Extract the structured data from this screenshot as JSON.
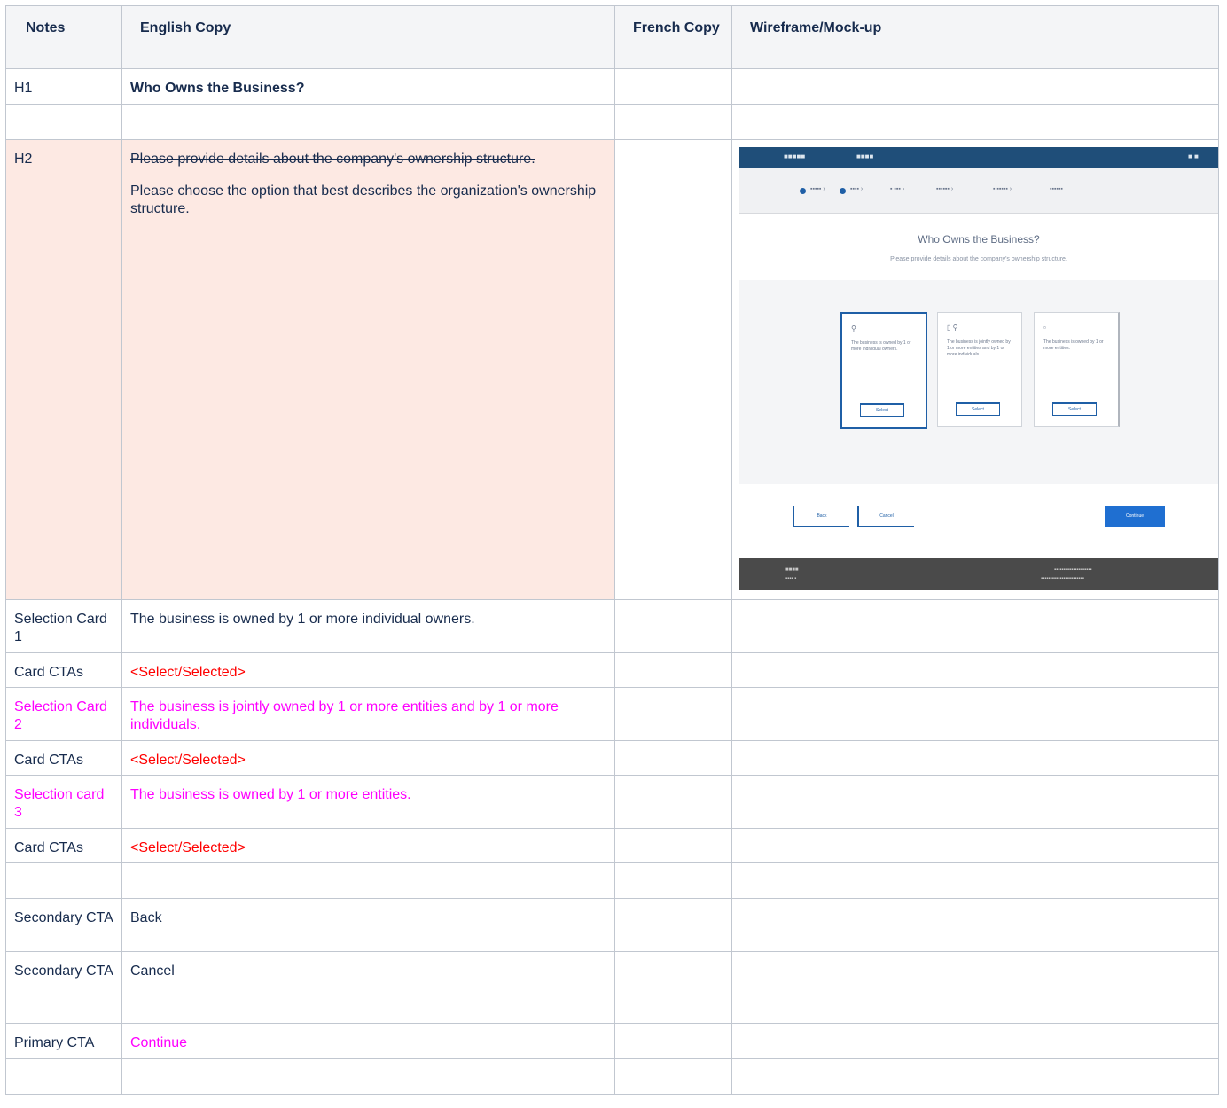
{
  "headers": {
    "notes": "Notes",
    "english": "English Copy",
    "french": "French Copy",
    "wireframe": "Wireframe/Mock-up"
  },
  "rows": [
    {
      "note": "H1",
      "copy": "Who Owns the Business?"
    },
    {
      "note": "",
      "copy": ""
    },
    {
      "note": "H2",
      "copy_struck": "Please provide details about the company's ownership structure.",
      "copy": "Please choose the option that best describes the organization's ownership structure."
    },
    {
      "note": "Selection Card 1",
      "copy": "The business is owned by 1 or more individual owners."
    },
    {
      "note": "Card CTAs",
      "copy": "<Select/Selected>"
    },
    {
      "note": "Selection Card 2",
      "copy": "The business is jointly owned by 1 or more entities and by 1 or more individuals."
    },
    {
      "note": "Card CTAs",
      "copy": "<Select/Selected>"
    },
    {
      "note": "Selection card 3",
      "copy": "The business is owned by 1 or more entities."
    },
    {
      "note": "Card CTAs",
      "copy": "<Select/Selected>"
    },
    {
      "note": "",
      "copy": ""
    },
    {
      "note": "Secondary CTA",
      "copy": "Back"
    },
    {
      "note": "Secondary CTA",
      "copy": "Cancel"
    },
    {
      "note": "Primary CTA",
      "copy": "Continue"
    },
    {
      "note": "",
      "copy": ""
    }
  ],
  "mockup": {
    "title": "Who Owns the Business?",
    "subtitle": "Please provide details about the company's ownership structure.",
    "card_ctas": [
      "Select",
      "Select",
      "Select"
    ]
  },
  "colors": {
    "red_text": "#ff0000",
    "magenta_text": "#ff00ff",
    "highlight_row": "#fde9e3"
  }
}
